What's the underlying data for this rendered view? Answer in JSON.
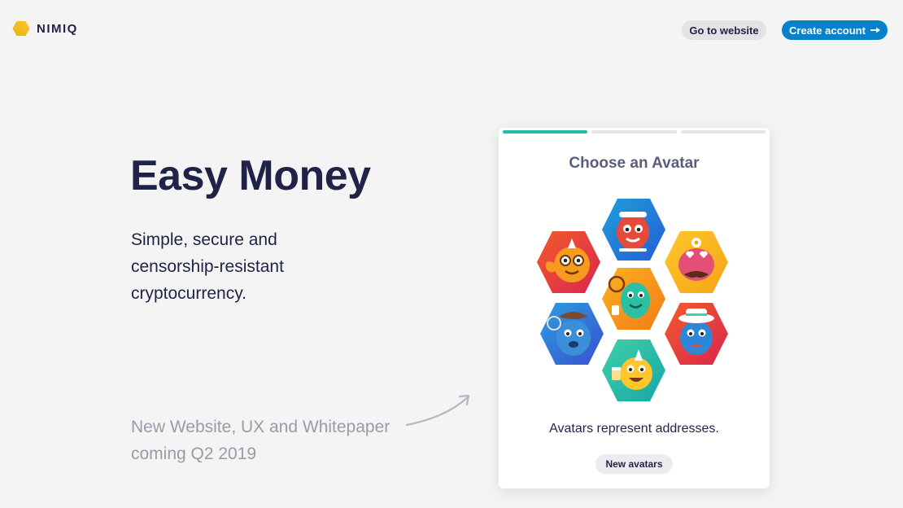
{
  "header": {
    "brand": "NIMIQ",
    "website_label": "Go to website",
    "create_label": "Create account"
  },
  "hero": {
    "title": "Easy Money",
    "subtitle": "Simple, secure and censorship-resistant cryptocurrency.",
    "news": "New Website, UX and Whitepaper coming Q2 2019"
  },
  "card": {
    "title": "Choose an Avatar",
    "caption": "Avatars represent addresses.",
    "chip": "New avatars",
    "progress_step": 1,
    "progress_total": 3
  },
  "colors": {
    "brand_gold": "#f6ae2d",
    "accent_blue": "#0582ca",
    "progress_green": "#21bca5",
    "text_dark": "#1f2348"
  },
  "icons": [
    "nimiq-logo-icon",
    "arrow-right-icon",
    "curved-arrow-icon"
  ]
}
